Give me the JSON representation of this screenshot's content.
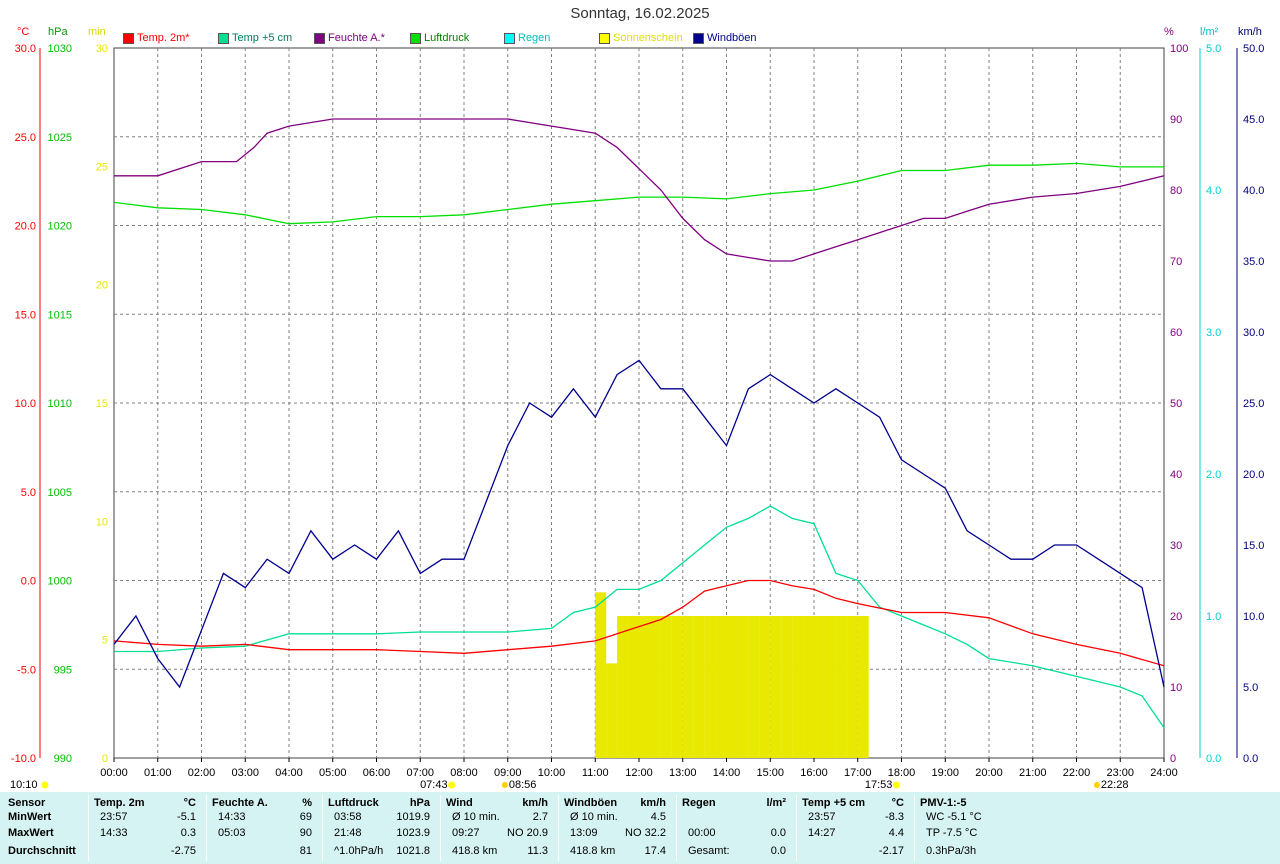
{
  "title": "Sonntag, 16.02.2025",
  "units": {
    "temp": "°C",
    "hpa": "hPa",
    "min": "min",
    "pct": "%",
    "rain": "l/m²",
    "kmh": "km/h"
  },
  "legend": [
    {
      "label": "Temp. 2m*",
      "color": "#ff0000",
      "text_color": "#ff0000"
    },
    {
      "label": "Temp +5 cm",
      "color": "#00e090",
      "text_color": "#008060"
    },
    {
      "label": "Feuchte A.*",
      "color": "#800080",
      "text_color": "#800080"
    },
    {
      "label": "Luftdruck",
      "color": "#00e000",
      "text_color": "#008000"
    },
    {
      "label": "Regen",
      "color": "#00ffff",
      "text_color": "#00c0c0"
    },
    {
      "label": "Sonnenschein",
      "color": "#ffff00",
      "text_color": "#e0e000"
    },
    {
      "label": "Windböen",
      "color": "#000090",
      "text_color": "#000090"
    }
  ],
  "colors": {
    "temp": "#ff0000",
    "hpa": "#00c000",
    "min": "#e8e800",
    "pct": "#800080",
    "rain": "#00d0d0",
    "kmh": "#000080",
    "grid": "#808080",
    "stats_bg": "#d6f3f3"
  },
  "axes": {
    "temp_ticks": [
      "30.0",
      "25.0",
      "20.0",
      "15.0",
      "10.0",
      "5.0",
      "0.0",
      "-5.0",
      "-10.0"
    ],
    "hpa_ticks": [
      "1030",
      "1025",
      "1020",
      "1015",
      "1010",
      "1005",
      "1000",
      "995",
      "990"
    ],
    "min_ticks": [
      "30",
      "25",
      "20",
      "15",
      "10",
      "5",
      "0"
    ],
    "pct_ticks": [
      "100",
      "90",
      "80",
      "70",
      "60",
      "50",
      "40",
      "30",
      "20",
      "10",
      "0"
    ],
    "rain_ticks": [
      "5.0",
      "4.0",
      "3.0",
      "2.0",
      "1.0",
      "0.0"
    ],
    "kmh_ticks": [
      "50.0",
      "45.0",
      "40.0",
      "35.0",
      "30.0",
      "25.0",
      "20.0",
      "15.0",
      "10.0",
      "5.0",
      "0.0"
    ],
    "x_ticks": [
      "00:00",
      "01:00",
      "02:00",
      "03:00",
      "04:00",
      "05:00",
      "06:00",
      "07:00",
      "08:00",
      "09:00",
      "10:00",
      "11:00",
      "12:00",
      "13:00",
      "14:00",
      "15:00",
      "16:00",
      "17:00",
      "18:00",
      "19:00",
      "20:00",
      "21:00",
      "22:00",
      "23:00",
      "24:00"
    ]
  },
  "markers": {
    "sunrise": "07:43",
    "moonset": "08:56",
    "sunset": "17:53",
    "moonrise": "22:28",
    "daylength": "10:10"
  },
  "chart_data": {
    "type": "line",
    "x_unit": "hours (00:00-24:00)",
    "series": [
      {
        "name": "Temp. 2m*",
        "unit": "°C",
        "x": [
          0,
          1,
          2,
          3,
          4,
          5,
          6,
          7,
          8,
          9,
          10,
          11,
          11.5,
          12,
          12.5,
          13,
          13.5,
          14,
          14.5,
          15,
          15.5,
          16,
          16.5,
          17,
          18,
          19,
          20,
          21,
          22,
          23,
          24
        ],
        "values": [
          -3.4,
          -3.6,
          -3.7,
          -3.6,
          -3.9,
          -3.9,
          -3.9,
          -4.0,
          -4.1,
          -3.9,
          -3.7,
          -3.4,
          -3.0,
          -2.6,
          -2.2,
          -1.5,
          -0.6,
          -0.3,
          0.0,
          0.0,
          -0.3,
          -0.5,
          -1.0,
          -1.3,
          -1.8,
          -1.8,
          -2.1,
          -3.0,
          -3.6,
          -4.1,
          -4.8
        ]
      },
      {
        "name": "Temp +5 cm",
        "unit": "°C",
        "x": [
          0,
          1,
          2,
          3,
          4,
          5,
          6,
          7,
          8,
          9,
          10,
          10.5,
          11,
          11.5,
          12,
          12.5,
          13,
          13.5,
          14,
          14.5,
          15,
          15.5,
          16,
          16.5,
          17,
          17.5,
          18,
          18.5,
          19,
          19.5,
          20,
          21,
          22,
          23,
          23.5,
          24
        ],
        "values": [
          -4.0,
          -4.0,
          -3.8,
          -3.7,
          -3.0,
          -3.0,
          -3.0,
          -2.9,
          -2.9,
          -2.9,
          -2.7,
          -1.8,
          -1.5,
          -0.5,
          -0.5,
          0.0,
          1.0,
          2.0,
          3.0,
          3.5,
          4.2,
          3.5,
          3.2,
          0.4,
          0.0,
          -1.5,
          -2.0,
          -2.5,
          -3.0,
          -3.6,
          -4.4,
          -4.8,
          -5.4,
          -6.0,
          -6.5,
          -8.3
        ]
      },
      {
        "name": "Feuchte A.*",
        "unit": "%",
        "x": [
          0,
          1,
          2,
          2.8,
          3.2,
          3.5,
          4,
          5,
          6,
          7,
          8,
          9,
          10,
          10.5,
          11,
          11.5,
          12,
          12.5,
          13,
          13.5,
          14,
          14.5,
          15,
          15.5,
          16,
          16.5,
          17,
          17.5,
          18,
          18.5,
          19,
          19.5,
          20,
          21,
          22,
          23,
          24
        ],
        "values": [
          82,
          82,
          84,
          84,
          86,
          88,
          89,
          90,
          90,
          90,
          90,
          90,
          89,
          88.5,
          88,
          86,
          83,
          80,
          76,
          73,
          71,
          70.5,
          70,
          70,
          71,
          72,
          73,
          74,
          75,
          76,
          76,
          77,
          78,
          79,
          79.5,
          80.5,
          82
        ]
      },
      {
        "name": "Luftdruck",
        "unit": "hPa",
        "x": [
          0,
          1,
          2,
          3,
          4,
          5,
          6,
          7,
          8,
          9,
          10,
          11,
          12,
          13,
          14,
          15,
          16,
          17,
          18,
          19,
          20,
          21,
          22,
          23,
          24
        ],
        "values": [
          1021.3,
          1021.0,
          1020.9,
          1020.6,
          1020.1,
          1020.2,
          1020.5,
          1020.5,
          1020.6,
          1020.9,
          1021.2,
          1021.4,
          1021.6,
          1021.6,
          1021.5,
          1021.8,
          1022.0,
          1022.5,
          1023.1,
          1023.1,
          1023.4,
          1023.4,
          1023.5,
          1023.3,
          1023.3
        ]
      },
      {
        "name": "Windböen",
        "unit": "km/h",
        "x": [
          0,
          0.5,
          1,
          1.5,
          2,
          2.5,
          3,
          3.5,
          4,
          4.5,
          5,
          5.5,
          6,
          6.5,
          7,
          7.5,
          8,
          8.5,
          9,
          9.5,
          10,
          10.5,
          11,
          11.5,
          12,
          12.5,
          13,
          13.5,
          14,
          14.5,
          15,
          15.5,
          16,
          16.5,
          17,
          17.5,
          18,
          18.5,
          19,
          19.5,
          20,
          20.5,
          21,
          21.5,
          22,
          22.5,
          23,
          23.5,
          24
        ],
        "values": [
          8,
          10,
          7,
          5,
          9,
          13,
          12,
          14,
          13,
          16,
          14,
          15,
          14,
          16,
          13,
          14,
          14,
          18,
          22,
          25,
          24,
          26,
          24,
          27,
          28,
          26,
          26,
          24,
          22,
          26,
          27,
          26,
          25,
          26,
          25,
          24,
          21,
          20,
          19,
          16,
          15,
          14,
          14,
          15,
          15,
          14,
          13,
          12,
          5
        ]
      },
      {
        "name": "Sonnenschein",
        "unit": "min",
        "x": [
          11,
          11.25,
          11.5,
          11.75,
          12,
          12.25,
          12.5,
          12.75,
          13,
          13.25,
          13.5,
          13.75,
          14,
          14.25,
          14.5,
          14.75,
          15,
          15.25,
          15.5,
          15.75,
          16,
          16.25,
          16.5,
          16.75,
          17,
          17.25,
          17.5
        ],
        "values": [
          7,
          4,
          6,
          6,
          6,
          6,
          6,
          6,
          6,
          6,
          6,
          6,
          6,
          6,
          6,
          6,
          6,
          6,
          6,
          6,
          6,
          6,
          6,
          6,
          6,
          0,
          0
        ]
      },
      {
        "name": "Regen",
        "unit": "l/m²",
        "x": [
          0,
          24
        ],
        "values": [
          0,
          0
        ]
      }
    ],
    "xlim": [
      0,
      24
    ],
    "ylim_temp": [
      -10,
      30
    ],
    "ylim_hpa": [
      990,
      1030
    ],
    "ylim_min": [
      0,
      30
    ],
    "ylim_pct": [
      0,
      100
    ],
    "ylim_rain": [
      0,
      5
    ],
    "ylim_kmh": [
      0,
      50
    ],
    "grid": true
  },
  "stats": {
    "columns": [
      {
        "header": "Sensor",
        "unit": "",
        "rows": [
          [
            "MinWert",
            "",
            ""
          ],
          [
            "MaxWert",
            "",
            ""
          ],
          [
            "Durchschnitt",
            "",
            ""
          ]
        ]
      },
      {
        "header": "Temp. 2m",
        "unit": "°C",
        "rows": [
          [
            "23:57",
            "",
            "-5.1"
          ],
          [
            "14:33",
            "",
            "0.3"
          ],
          [
            "",
            "",
            "-2.75"
          ]
        ]
      },
      {
        "header": "Feuchte A.",
        "unit": "%",
        "rows": [
          [
            "14:33",
            "",
            "69"
          ],
          [
            "05:03",
            "",
            "90"
          ],
          [
            "",
            "",
            "81"
          ]
        ]
      },
      {
        "header": "Luftdruck",
        "unit": "hPa",
        "rows": [
          [
            "03:58",
            "",
            "1019.9"
          ],
          [
            "21:48",
            "",
            "1023.9"
          ],
          [
            "^1.0hPa/h",
            "",
            "1021.8"
          ]
        ]
      },
      {
        "header": "Wind",
        "unit": "km/h",
        "rows": [
          [
            "Ø 10 min.",
            "",
            "2.7"
          ],
          [
            "09:27",
            "NO 20.9",
            ""
          ],
          [
            "418.8 km",
            "",
            "11.3"
          ]
        ]
      },
      {
        "header": "Windböen",
        "unit": "km/h",
        "rows": [
          [
            "Ø 10 min.",
            "",
            "4.5"
          ],
          [
            "13:09",
            "NO 32.2",
            ""
          ],
          [
            "418.8 km",
            "",
            "17.4"
          ]
        ]
      },
      {
        "header": "Regen",
        "unit": "l/m²",
        "rows": [
          [
            "",
            "",
            ""
          ],
          [
            "00:00",
            "",
            "0.0"
          ],
          [
            "Gesamt:",
            "",
            "0.0"
          ]
        ]
      },
      {
        "header": "Temp +5 cm",
        "unit": "°C",
        "rows": [
          [
            "23:57",
            "",
            "-8.3"
          ],
          [
            "14:27",
            "",
            "4.4"
          ],
          [
            "",
            "",
            "-2.17"
          ]
        ]
      },
      {
        "header": "PMV-1:-5",
        "unit": "",
        "rows": [
          [
            "WC -5.1 °C",
            "",
            ""
          ],
          [
            "TP -7.5 °C",
            "",
            ""
          ],
          [
            "0.3hPa/3h",
            "",
            ""
          ]
        ]
      }
    ]
  }
}
